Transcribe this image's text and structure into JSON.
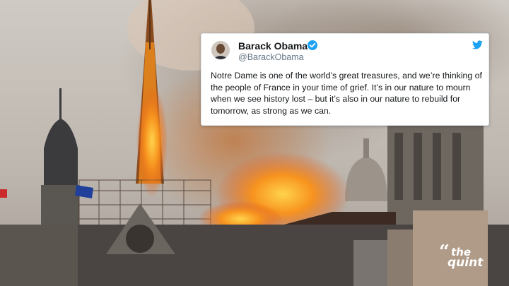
{
  "tweet": {
    "name": "Barack Obama",
    "handle": "@BarackObama",
    "text": "Notre Dame is one of the world’s great treasures, and we’re thinking of the people of France in your time of grief. It’s in our nature to mourn when we see history lost – but it’s also in our nature to rebuild for tomorrow, as strong as we can.",
    "verified": true
  },
  "watermark": {
    "line1": "the",
    "line2": "quint"
  },
  "icons": {
    "verified": "verified-badge-icon",
    "brand": "twitter-bird-icon"
  },
  "colors": {
    "twitter_blue": "#1da1f2",
    "fire": "#f7931e",
    "smoke": "#8f8580"
  }
}
